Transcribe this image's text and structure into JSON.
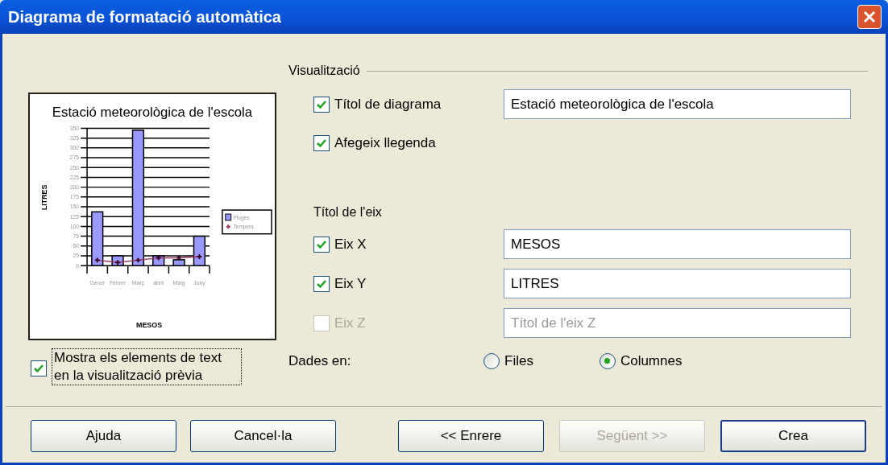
{
  "window": {
    "title": "Diagrama de formatació automàtica"
  },
  "preview": {
    "chart_data": {
      "type": "bar",
      "title": "Estació meteorològica de l'escola",
      "xlabel": "MESOS",
      "ylabel": "LITRES",
      "categories": [
        "Gener",
        "Febrer",
        "Març",
        "abril",
        "Maig",
        "Juny"
      ],
      "series": [
        {
          "name": "Pluges",
          "type": "bar",
          "color": "#9999ff",
          "values": [
            137,
            25,
            345,
            25,
            15,
            75
          ]
        },
        {
          "name": "Tempera.",
          "type": "line",
          "marker": "plus",
          "color": "#993366",
          "values": [
            14,
            8,
            14,
            20,
            20,
            23
          ]
        }
      ],
      "grid": true,
      "legend": "right",
      "ylim": [
        0,
        350
      ],
      "yticks": [
        0,
        25,
        50,
        75,
        100,
        125,
        150,
        175,
        200,
        225,
        250,
        275,
        300,
        325,
        350
      ]
    }
  },
  "show_text": {
    "label": "Mostra els elements de text en la visualització prèvia",
    "checked": true
  },
  "display": {
    "heading": "Visualització",
    "rows": [
      {
        "kind": "field",
        "label": "Títol de diagrama",
        "checked": true,
        "value": "Estació meteorològica de l'escola"
      },
      {
        "kind": "check",
        "label": "Afegeix llegenda",
        "checked": true
      }
    ]
  },
  "axis_titles": {
    "heading": "Títol de l'eix",
    "rows": [
      {
        "label": "Eix X",
        "checked": true,
        "disabled": false,
        "value": "MESOS"
      },
      {
        "label": "Eix Y",
        "checked": true,
        "disabled": false,
        "value": "LITRES"
      },
      {
        "label": "Eix Z",
        "checked": false,
        "disabled": true,
        "placeholder": "Títol de l'eix Z"
      }
    ]
  },
  "data_in": {
    "label": "Dades en:",
    "options": [
      {
        "label": "Files",
        "selected": false
      },
      {
        "label": "Columnes",
        "selected": true
      }
    ]
  },
  "buttons": [
    {
      "label": "Ajuda",
      "disabled": false,
      "default": false
    },
    {
      "label": "Cancel·la",
      "disabled": false,
      "default": false
    },
    {
      "label": "<< Enrere",
      "disabled": false,
      "default": false
    },
    {
      "label": "Següent >>",
      "disabled": true,
      "default": false
    },
    {
      "label": "Crea",
      "disabled": false,
      "default": true
    }
  ]
}
